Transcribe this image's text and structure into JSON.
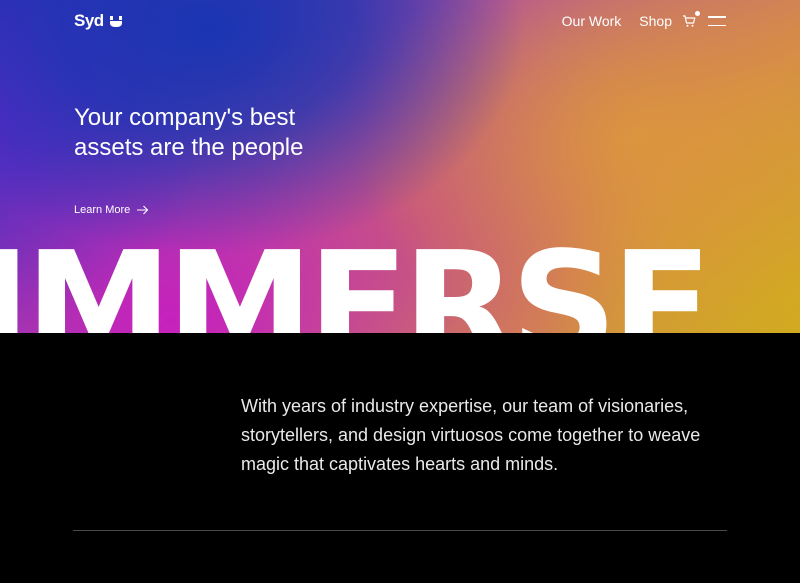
{
  "header": {
    "logo": "Syd",
    "nav": [
      {
        "label": "Our Work"
      },
      {
        "label": "Shop"
      }
    ],
    "cart_icon": "cart-icon",
    "menu_icon": "hamburger-menu-icon"
  },
  "hero": {
    "headline": "Your company's best assets are the people",
    "cta": "Learn More",
    "cta_icon": "arrow-right-icon",
    "big_word": "IMMERSE"
  },
  "intro": {
    "text": "With years of industry expertise, our team of visionaries, storytellers, and design virtuosos come together to weave magic that captivates hearts and minds."
  },
  "colors": {
    "hero_blue": "#1634b2",
    "hero_magenta": "#c81ebe",
    "hero_orange": "#dc963c",
    "hero_gold": "#d2aa1e",
    "background": "#000000",
    "divider": "#4a4a4a"
  }
}
